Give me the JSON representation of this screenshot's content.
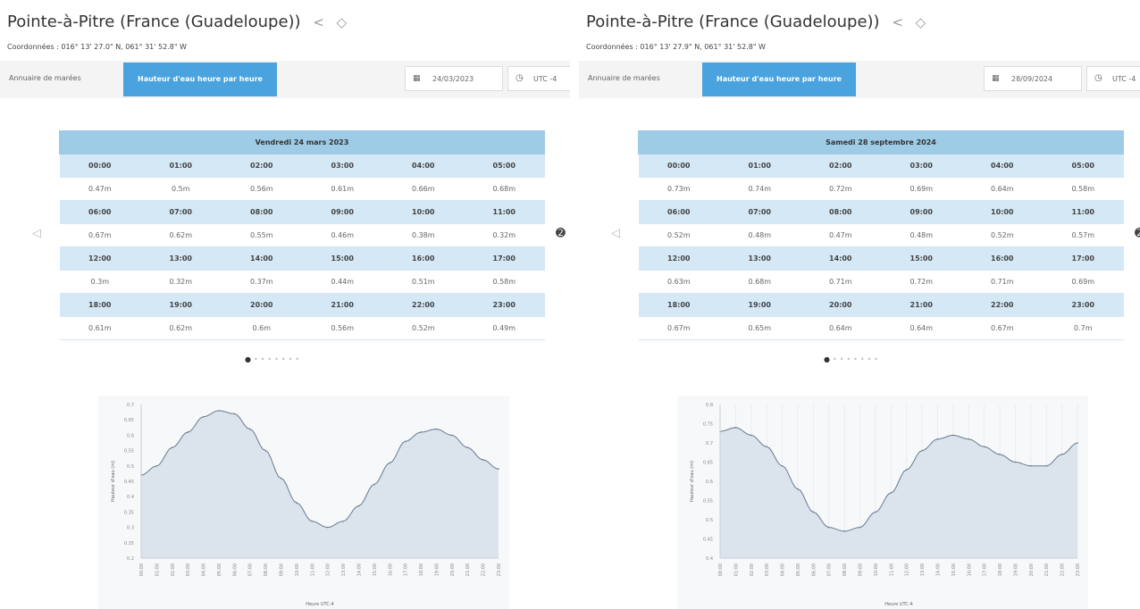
{
  "panels": [
    {
      "title": "Pointe-à-Pitre (France (Guadeloupe))",
      "coords": "Coordonnées : 016° 13' 27.0\" N, 061° 31' 52.8\" W",
      "toolbar": {
        "annuaire": "Annuaire de marées",
        "hourly_button": "Hauteur d'eau heure par heure",
        "date": "24/03/2023",
        "utc": "UTC -4"
      },
      "table": {
        "caption": "Vendredi 24 mars 2023",
        "rows": [
          {
            "hours": [
              "00:00",
              "01:00",
              "02:00",
              "03:00",
              "04:00",
              "05:00"
            ],
            "values": [
              "0.47m",
              "0.5m",
              "0.56m",
              "0.61m",
              "0.66m",
              "0.68m"
            ]
          },
          {
            "hours": [
              "06:00",
              "07:00",
              "08:00",
              "09:00",
              "10:00",
              "11:00"
            ],
            "values": [
              "0.67m",
              "0.62m",
              "0.55m",
              "0.46m",
              "0.38m",
              "0.32m"
            ]
          },
          {
            "hours": [
              "12:00",
              "13:00",
              "14:00",
              "15:00",
              "16:00",
              "17:00"
            ],
            "values": [
              "0.3m",
              "0.32m",
              "0.37m",
              "0.44m",
              "0.51m",
              "0.58m"
            ]
          },
          {
            "hours": [
              "18:00",
              "19:00",
              "20:00",
              "21:00",
              "22:00",
              "23:00"
            ],
            "values": [
              "0.61m",
              "0.62m",
              "0.6m",
              "0.56m",
              "0.52m",
              "0.49m"
            ]
          }
        ]
      },
      "colors": {
        "accent": "#4aa3de",
        "header": "#9ecbe6",
        "hour_row": "#d4e8f6",
        "area_fill": "#dbe4ed",
        "line": "#6a7a8c"
      }
    },
    {
      "title": "Pointe-à-Pitre (France (Guadeloupe))",
      "coords": "Coordonnées : 016° 13' 27.9\" N, 061° 31' 52.8\" W",
      "toolbar": {
        "annuaire": "Annuaire de marées",
        "hourly_button": "Hauteur d'eau heure par heure",
        "date": "28/09/2024",
        "utc": "UTC -4"
      },
      "table": {
        "caption": "Samedi 28 septembre 2024",
        "rows": [
          {
            "hours": [
              "00:00",
              "01:00",
              "02:00",
              "03:00",
              "04:00",
              "05:00"
            ],
            "values": [
              "0.73m",
              "0.74m",
              "0.72m",
              "0.69m",
              "0.64m",
              "0.58m"
            ]
          },
          {
            "hours": [
              "06:00",
              "07:00",
              "08:00",
              "09:00",
              "10:00",
              "11:00"
            ],
            "values": [
              "0.52m",
              "0.48m",
              "0.47m",
              "0.48m",
              "0.52m",
              "0.57m"
            ]
          },
          {
            "hours": [
              "12:00",
              "13:00",
              "14:00",
              "15:00",
              "16:00",
              "17:00"
            ],
            "values": [
              "0.63m",
              "0.68m",
              "0.71m",
              "0.72m",
              "0.71m",
              "0.69m"
            ]
          },
          {
            "hours": [
              "18:00",
              "19:00",
              "20:00",
              "21:00",
              "22:00",
              "23:00"
            ],
            "values": [
              "0.67m",
              "0.65m",
              "0.64m",
              "0.64m",
              "0.67m",
              "0.7m"
            ]
          }
        ]
      },
      "colors": {
        "accent": "#4aa3de",
        "header": "#9ecbe6",
        "hour_row": "#d4e8f6",
        "area_fill": "#dbe4ed",
        "line": "#6a7a8c"
      }
    }
  ],
  "icons": {
    "share": "share-icon",
    "tag": "tag-icon",
    "calendar": "calendar-icon",
    "clock": "clock-icon",
    "prev": "chevron-left-icon",
    "next": "chevron-right-icon"
  },
  "chart_data": [
    {
      "type": "area",
      "x": [
        "00:00",
        "01:00",
        "02:00",
        "03:00",
        "04:00",
        "05:00",
        "06:00",
        "07:00",
        "08:00",
        "09:00",
        "10:00",
        "11:00",
        "12:00",
        "13:00",
        "14:00",
        "15:00",
        "16:00",
        "17:00",
        "18:00",
        "19:00",
        "20:00",
        "21:00",
        "22:00",
        "23:00"
      ],
      "y": [
        0.47,
        0.5,
        0.56,
        0.61,
        0.66,
        0.68,
        0.67,
        0.62,
        0.55,
        0.46,
        0.38,
        0.32,
        0.3,
        0.32,
        0.37,
        0.44,
        0.51,
        0.58,
        0.61,
        0.62,
        0.6,
        0.56,
        0.52,
        0.49
      ],
      "ylim": [
        0.2,
        0.7
      ],
      "yticks": [
        "0.7",
        "0.65",
        "0.6",
        "0.55",
        "0.5",
        "0.45",
        "0.4",
        "0.35",
        "0.3",
        "0.25",
        "0.2"
      ],
      "ylabel": "Hauteur d'eau (m)",
      "xlabel": "Heure UTC-4",
      "grid": false
    },
    {
      "type": "area",
      "x": [
        "00:00",
        "01:00",
        "02:00",
        "03:00",
        "04:00",
        "05:00",
        "06:00",
        "07:00",
        "08:00",
        "09:00",
        "10:00",
        "11:00",
        "12:00",
        "13:00",
        "14:00",
        "15:00",
        "16:00",
        "17:00",
        "18:00",
        "19:00",
        "20:00",
        "21:00",
        "22:00",
        "23:00"
      ],
      "y": [
        0.73,
        0.74,
        0.72,
        0.69,
        0.64,
        0.58,
        0.52,
        0.48,
        0.47,
        0.48,
        0.52,
        0.57,
        0.63,
        0.68,
        0.71,
        0.72,
        0.71,
        0.69,
        0.67,
        0.65,
        0.64,
        0.64,
        0.67,
        0.7
      ],
      "ylim": [
        0.4,
        0.8
      ],
      "yticks": [
        "0.8",
        "0.75",
        "0.7",
        "0.65",
        "0.6",
        "0.55",
        "0.5",
        "0.45",
        "0.4"
      ],
      "ylabel": "Hauteur d'eau (m)",
      "xlabel": "Heure UTC-4",
      "grid": true
    }
  ]
}
